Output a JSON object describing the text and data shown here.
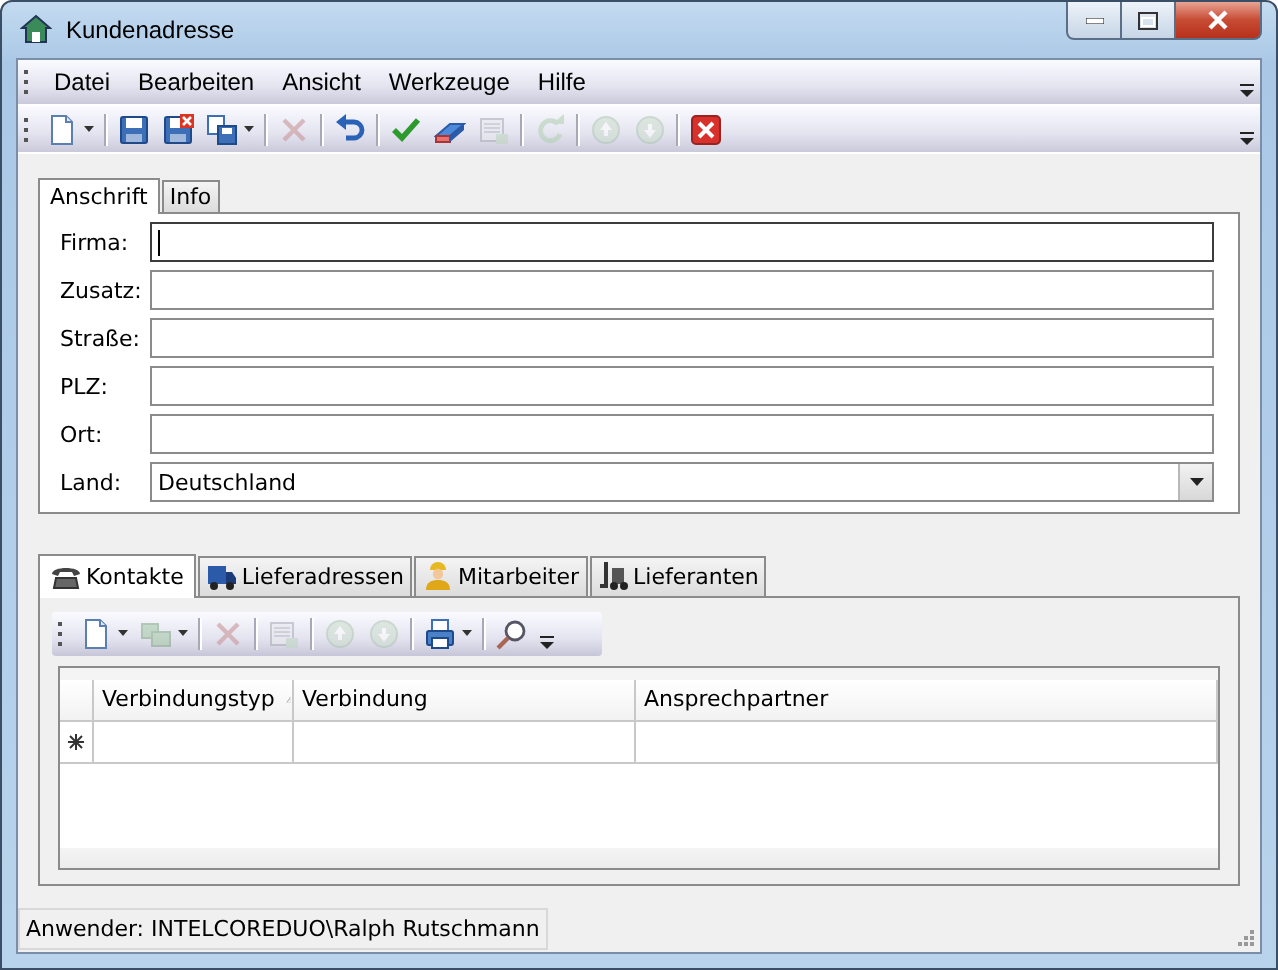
{
  "window": {
    "title": "Kundenadresse"
  },
  "menu": [
    "Datei",
    "Bearbeiten",
    "Ansicht",
    "Werkzeuge",
    "Hilfe"
  ],
  "toolbar": [
    {
      "kind": "new",
      "disabled": false,
      "dropdown": true
    },
    {
      "kind": "separator"
    },
    {
      "kind": "save",
      "disabled": false,
      "dropdown": false
    },
    {
      "kind": "save-close",
      "disabled": false,
      "dropdown": false
    },
    {
      "kind": "copy",
      "disabled": false,
      "dropdown": true
    },
    {
      "kind": "separator"
    },
    {
      "kind": "delete",
      "disabled": true,
      "dropdown": false
    },
    {
      "kind": "separator"
    },
    {
      "kind": "undo",
      "disabled": false,
      "dropdown": false
    },
    {
      "kind": "separator"
    },
    {
      "kind": "check",
      "disabled": false,
      "dropdown": false
    },
    {
      "kind": "eraser",
      "disabled": false,
      "dropdown": false
    },
    {
      "kind": "form",
      "disabled": true,
      "dropdown": false
    },
    {
      "kind": "separator"
    },
    {
      "kind": "redo",
      "disabled": true,
      "dropdown": false
    },
    {
      "kind": "separator"
    },
    {
      "kind": "up",
      "disabled": true,
      "dropdown": false
    },
    {
      "kind": "down",
      "disabled": true,
      "dropdown": false
    },
    {
      "kind": "separator"
    },
    {
      "kind": "close",
      "disabled": false,
      "dropdown": false
    }
  ],
  "address_tabs": [
    {
      "label": "Anschrift",
      "selected": true
    },
    {
      "label": "Info",
      "selected": false
    }
  ],
  "fields": [
    {
      "label": "Firma:",
      "kind": "text",
      "focused": true
    },
    {
      "label": "Zusatz:",
      "kind": "text",
      "focused": false
    },
    {
      "label": "Straße:",
      "kind": "text",
      "focused": false
    },
    {
      "label": "PLZ:",
      "kind": "text",
      "focused": false
    },
    {
      "label": "Ort:",
      "kind": "text",
      "focused": false
    },
    {
      "label": "Land:",
      "kind": "combo",
      "value": "Deutschland"
    }
  ],
  "detail_tabs": [
    {
      "label": "Kontakte",
      "kind": "phone",
      "selected": true
    },
    {
      "label": "Lieferadressen",
      "kind": "truck",
      "selected": false
    },
    {
      "label": "Mitarbeiter",
      "kind": "person",
      "selected": false
    },
    {
      "label": "Lieferanten",
      "kind": "forklift",
      "selected": false
    }
  ],
  "grid_toolbar": [
    {
      "kind": "new",
      "disabled": false,
      "dropdown": true
    },
    {
      "kind": "copy-green",
      "disabled": true,
      "dropdown": true
    },
    {
      "kind": "separator"
    },
    {
      "kind": "delete",
      "disabled": true,
      "dropdown": false
    },
    {
      "kind": "separator"
    },
    {
      "kind": "form",
      "disabled": true,
      "dropdown": false
    },
    {
      "kind": "separator"
    },
    {
      "kind": "up",
      "disabled": true,
      "dropdown": false
    },
    {
      "kind": "down",
      "disabled": true,
      "dropdown": false
    },
    {
      "kind": "separator"
    },
    {
      "kind": "print",
      "disabled": false,
      "dropdown": true
    },
    {
      "kind": "separator"
    },
    {
      "kind": "search",
      "disabled": false,
      "dropdown": false
    }
  ],
  "table": {
    "columns": [
      {
        "label": "Verbindungstyp",
        "sorted": true
      },
      {
        "label": "Verbindung",
        "sorted": false
      },
      {
        "label": "Ansprechpartner",
        "sorted": false
      }
    ]
  },
  "status_bar": "Anwender: INTELCOREDUO\\Ralph Rutschmann"
}
